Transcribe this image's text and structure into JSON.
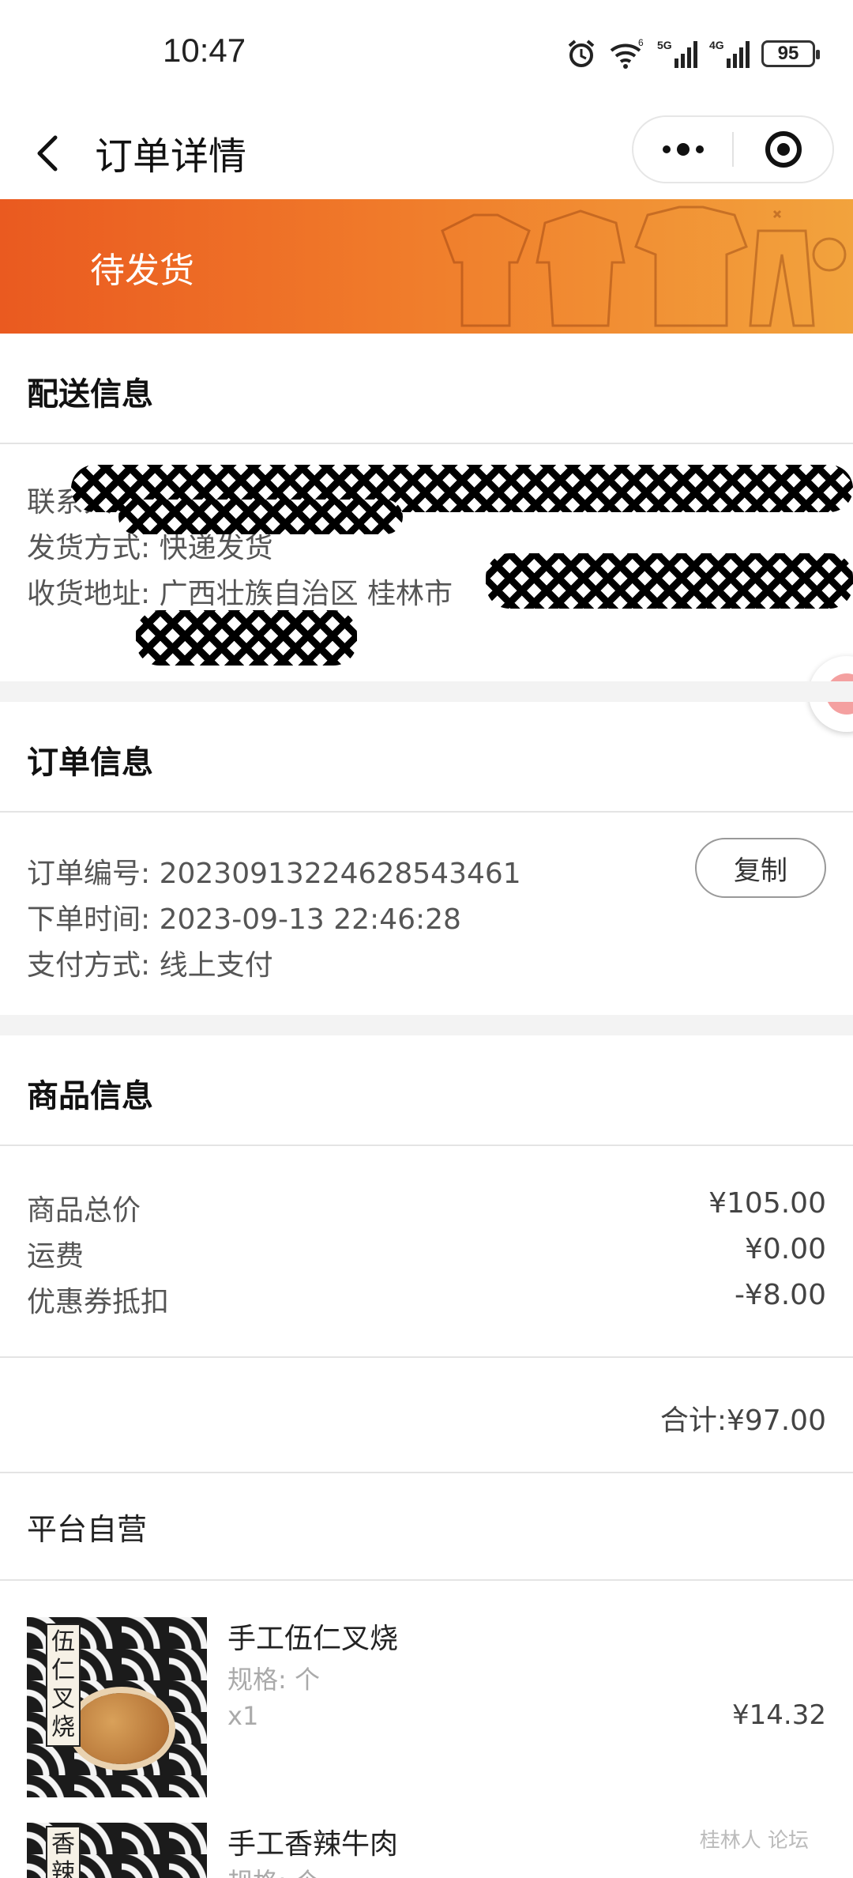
{
  "status_bar": {
    "time": "10:47",
    "battery": "95",
    "wifi_label": "6",
    "sig1_label": "5G",
    "sig2_label": "4G"
  },
  "nav": {
    "title": "订单详情"
  },
  "banner": {
    "status": "待发货"
  },
  "delivery": {
    "title": "配送信息",
    "contact_label": "联系人:",
    "shipping_label": "发货方式:",
    "shipping_value": "快递发货",
    "address_label": "收货地址:",
    "address_value": "广西壮族自治区 桂林市"
  },
  "order": {
    "title": "订单信息",
    "number_label": "订单编号:",
    "number_value": "20230913224628543461",
    "copy_label": "复制",
    "time_label": "下单时间:",
    "time_value": "2023-09-13 22:46:28",
    "pay_label": "支付方式:",
    "pay_value": "线上支付"
  },
  "goods": {
    "title": "商品信息",
    "total_label": "商品总价",
    "total_value": "¥105.00",
    "freight_label": "运费",
    "freight_value": "¥0.00",
    "coupon_label": "优惠券抵扣",
    "coupon_value": "-¥8.00",
    "sum": "合计:¥97.00"
  },
  "shop": {
    "name": "平台自营"
  },
  "products": [
    {
      "name": "手工伍仁叉烧",
      "spec": "规格: 个",
      "qty": "x1",
      "price": "¥14.32",
      "label": "伍仁叉烧"
    },
    {
      "name": "手工香辣牛肉",
      "spec": "规格: 个",
      "label": "香辣"
    }
  ],
  "watermark": "桂林人 论坛",
  "colors": {
    "banner_start": "#ea5a20",
    "banner_end": "#f2a33d"
  }
}
